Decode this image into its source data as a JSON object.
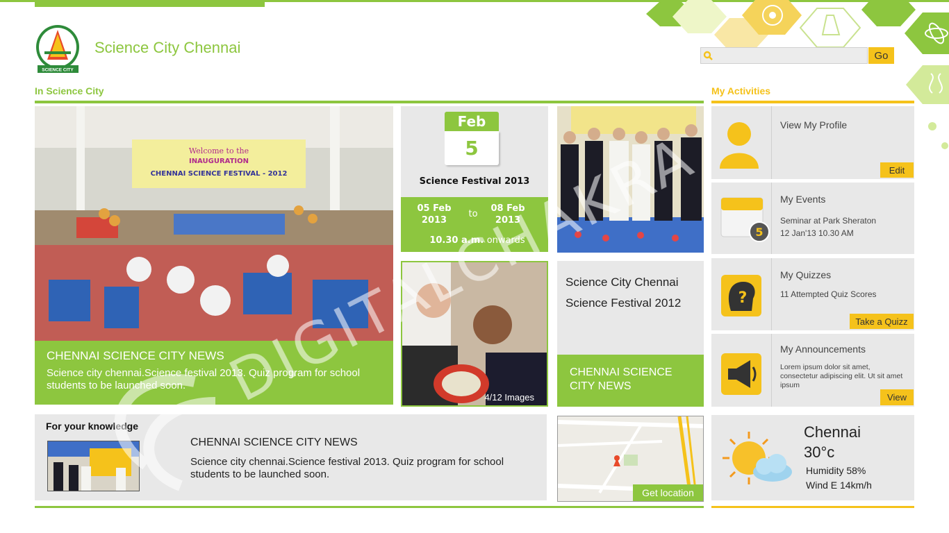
{
  "header": {
    "site_title": "Science City Chennai",
    "logo_text": "SCIENCE CITY",
    "search_placeholder": "",
    "go_label": "Go"
  },
  "sections": {
    "left_heading": "In Science City",
    "right_heading": "My Activities"
  },
  "main_tile": {
    "title": "CHENNAI SCIENCE CITY NEWS",
    "body": "Science city chennai.Science festival 2013. Quiz program for school students to be launched soon.",
    "banner_line1": "Welcome to the",
    "banner_line2": "INAUGURATION",
    "banner_line3": "CHENNAI SCIENCE FESTIVAL - 2012"
  },
  "event": {
    "month": "Feb",
    "day": "5",
    "title": "Science Festival 2013",
    "from": "05 Feb 2013",
    "to_label": "to",
    "to": "08 Feb 2013",
    "time_bold": "10.30 a.m.",
    "time_rest": "onwards"
  },
  "gallery": {
    "count": "4/12 Images"
  },
  "festival": {
    "title": "Science City Chennai Science Festival 2012",
    "news": "CHENNAI SCIENCE CITY NEWS"
  },
  "knowledge": {
    "heading": "For your knowledge",
    "title": "CHENNAI SCIENCE CITY NEWS",
    "body": "Science city chennai.Science festival 2013. Quiz program for school students to be launched soon."
  },
  "map": {
    "cta": "Get location"
  },
  "activities": {
    "profile": {
      "label": "View My Profile",
      "button": "Edit"
    },
    "events": {
      "label": "My Events",
      "line1": "Seminar at Park Sheraton",
      "line2": "12 Jan'13 10.30 AM",
      "badge": "5"
    },
    "quizzes": {
      "label": "My Quizzes",
      "line1": "11 Attempted  Quiz Scores",
      "button": "Take a Quizz"
    },
    "announcements": {
      "label": "My Announcements",
      "body": "Lorem ipsum dolor sit amet, consectetur adipiscing elit. Ut sit amet ipsum",
      "button": "View"
    }
  },
  "weather": {
    "city": "Chennai",
    "temp": "30°c",
    "humidity": "Humidity 58%",
    "wind": "Wind E 14km/h"
  },
  "watermark": "DIGITALCHAKRA",
  "colors": {
    "green": "#8dc63f",
    "yellow": "#f5c21b",
    "tile_grey": "#e8e8e8"
  }
}
